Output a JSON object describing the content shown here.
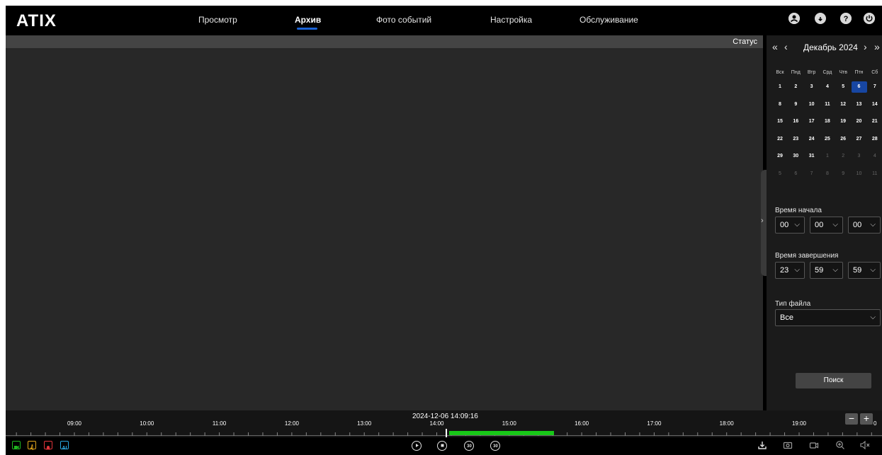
{
  "brand": {
    "logo_text": "ATIX"
  },
  "nav": {
    "items": [
      {
        "label": "Просмотр"
      },
      {
        "label": "Архив",
        "active": true
      },
      {
        "label": "Фото событий"
      },
      {
        "label": "Настройка"
      },
      {
        "label": "Обслуживание"
      }
    ]
  },
  "top_icons": [
    "user-icon",
    "download-cloud-icon",
    "help-icon",
    "power-icon"
  ],
  "video": {
    "status_label": "Статус"
  },
  "calendar": {
    "title": "Декабрь 2024",
    "weekdays": [
      "Вск",
      "Пнд",
      "Втр",
      "Срд",
      "Чтв",
      "Птн",
      "Сб"
    ],
    "weeks": [
      [
        "1",
        "2",
        "3",
        "4",
        "5",
        "6",
        "7"
      ],
      [
        "8",
        "9",
        "10",
        "11",
        "12",
        "13",
        "14"
      ],
      [
        "15",
        "16",
        "17",
        "18",
        "19",
        "20",
        "21"
      ],
      [
        "22",
        "23",
        "24",
        "25",
        "26",
        "27",
        "28"
      ],
      [
        "29",
        "30",
        "31",
        "1",
        "2",
        "3",
        "4"
      ],
      [
        "5",
        "6",
        "7",
        "8",
        "9",
        "10",
        "11"
      ]
    ],
    "selected_day": "6"
  },
  "search": {
    "start_label": "Время начала",
    "start": [
      "00",
      "00",
      "00"
    ],
    "end_label": "Время завершения",
    "end": [
      "23",
      "59",
      "59"
    ],
    "file_type_label": "Тип файла",
    "file_type": "Все",
    "button": "Поиск"
  },
  "timeline": {
    "current": "2024-12-06 14:09:16",
    "hours": [
      "09:00",
      "10:00",
      "11:00",
      "12:00",
      "13:00",
      "14:00",
      "15:00",
      "16:00",
      "17:00",
      "18:00",
      "19:00"
    ],
    "zoom_out": "−",
    "zoom_in": "+",
    "edge_label": "0"
  },
  "colors": {
    "accent": "#1b63d6",
    "recording": "#18c818",
    "legend_green": "#1fb81f",
    "legend_yellow": "#e2a51b",
    "legend_red": "#e0343a",
    "legend_blue": "#2aa8e0"
  }
}
